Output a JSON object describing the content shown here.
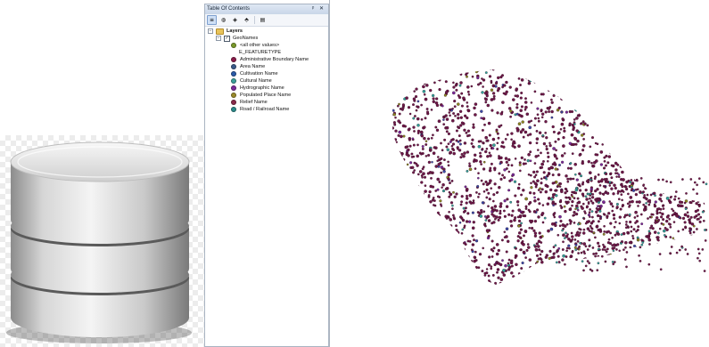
{
  "toc": {
    "title": "Table Of Contents",
    "title_buttons": "ᵖ ✕",
    "toolbar": [
      {
        "name": "list-by-drawing-order",
        "glyph": "≡",
        "active": true
      },
      {
        "name": "list-by-source",
        "glyph": "◍",
        "active": false
      },
      {
        "name": "list-by-visibility",
        "glyph": "◈",
        "active": false
      },
      {
        "name": "list-by-selection",
        "glyph": "⬘",
        "active": false
      },
      {
        "name": "options",
        "glyph": "▤",
        "active": false
      }
    ],
    "layers_label": "Layers",
    "layer_name": "GeoNames",
    "legend_items": [
      {
        "label": "<all other values>",
        "color": "#7a9a2a"
      },
      {
        "label": "E_FEATURETYPE",
        "color": null
      },
      {
        "label": "Administrative Boundary Name",
        "color": "#8a1a4a"
      },
      {
        "label": "Area Name",
        "color": "#3a5a8a"
      },
      {
        "label": "Cultivation Name",
        "color": "#2a5aa8"
      },
      {
        "label": "Cultural Name",
        "color": "#3aa09a"
      },
      {
        "label": "Hydrographic Name",
        "color": "#7a2a9a"
      },
      {
        "label": "Populated Place Name",
        "color": "#9a8a2a"
      },
      {
        "label": "Relief Name",
        "color": "#8a2a4a"
      },
      {
        "label": "Road / Railroad Name",
        "color": "#2a8a8a"
      }
    ]
  },
  "map": {
    "dominant_color": "#6e1848",
    "accent_colors": [
      "#2fa39a",
      "#8d8a22",
      "#3a4aa8",
      "#7a2a9a"
    ]
  }
}
